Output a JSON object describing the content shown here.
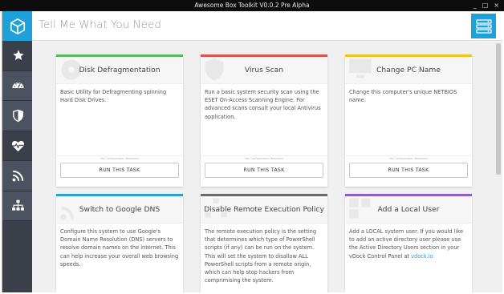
{
  "window": {
    "title": "Awesome Box Toolkit V0.0.2 Pre Alpha",
    "controls": [
      "_",
      "□",
      "×"
    ]
  },
  "header": {
    "title": "Tell Me What You Need",
    "logo_icon": "cube-icon",
    "menu_icon": "hamburger-menu-icon"
  },
  "sidebar": {
    "items": [
      {
        "icon": "star-icon"
      },
      {
        "icon": "dashboard-gauge-icon"
      },
      {
        "icon": "shield-icon"
      },
      {
        "icon": "heart-pulse-icon"
      },
      {
        "icon": "rss-feed-icon"
      },
      {
        "icon": "network-sitemap-icon"
      }
    ]
  },
  "colors": {
    "accent": "#1ea0d8",
    "sidebar": "#3a3f49",
    "green": "#5cb85c",
    "red": "#d9534f",
    "yellow": "#f0c419",
    "blue": "#2a9fd6",
    "gray": "#6b6b6b",
    "purple": "#8e5fc4"
  },
  "cards": [
    {
      "title": "Disk Defragmentation",
      "description": "Basic Utility for Defragmenting spinning Hard Disk Drives.",
      "note": "No Configuration Required",
      "button": "RUN THIS TASK",
      "bar_color": "#5cb85c"
    },
    {
      "title": "Virus Scan",
      "description": "Run a basic system security scan using the ESET On-Access Scanning Engine. For advanced scans consult your local Antivirus application.",
      "note": "No Configuration Required",
      "button": "RUN THIS TASK",
      "bar_color": "#d9534f"
    },
    {
      "title": "Change PC Name",
      "description": "Change this computer's unique NETBIOS name.",
      "note": "No Configuration Required",
      "button": "RUN THIS TASK",
      "bar_color": "#f0c419"
    },
    {
      "title": "Switch to Google DNS",
      "description": "Configure this system to use Google's Domain Name Resolution (DNS) servers to resolve domain names on the internet. This can help increase your overall web browsing speeds.",
      "bar_color": "#2a9fd6"
    },
    {
      "title": "Disable Remote Execution Policy",
      "description": "The remote execution policy is the setting that determines which type of PowerShell scripts (if any) can be run on the system. This will set the system to disallow ALL PowerShell scripts from a remote origin, which can help stop hackers from comprimising the system.",
      "bar_color": "#6b6b6b"
    },
    {
      "title": "Add a Local User",
      "description": "Add a LOCAL system user. If you would like to add an active directory user please use the Active Directory Users section in your vDock Control Panel at",
      "link": "vdock.io",
      "bar_color": "#8e5fc4"
    }
  ]
}
